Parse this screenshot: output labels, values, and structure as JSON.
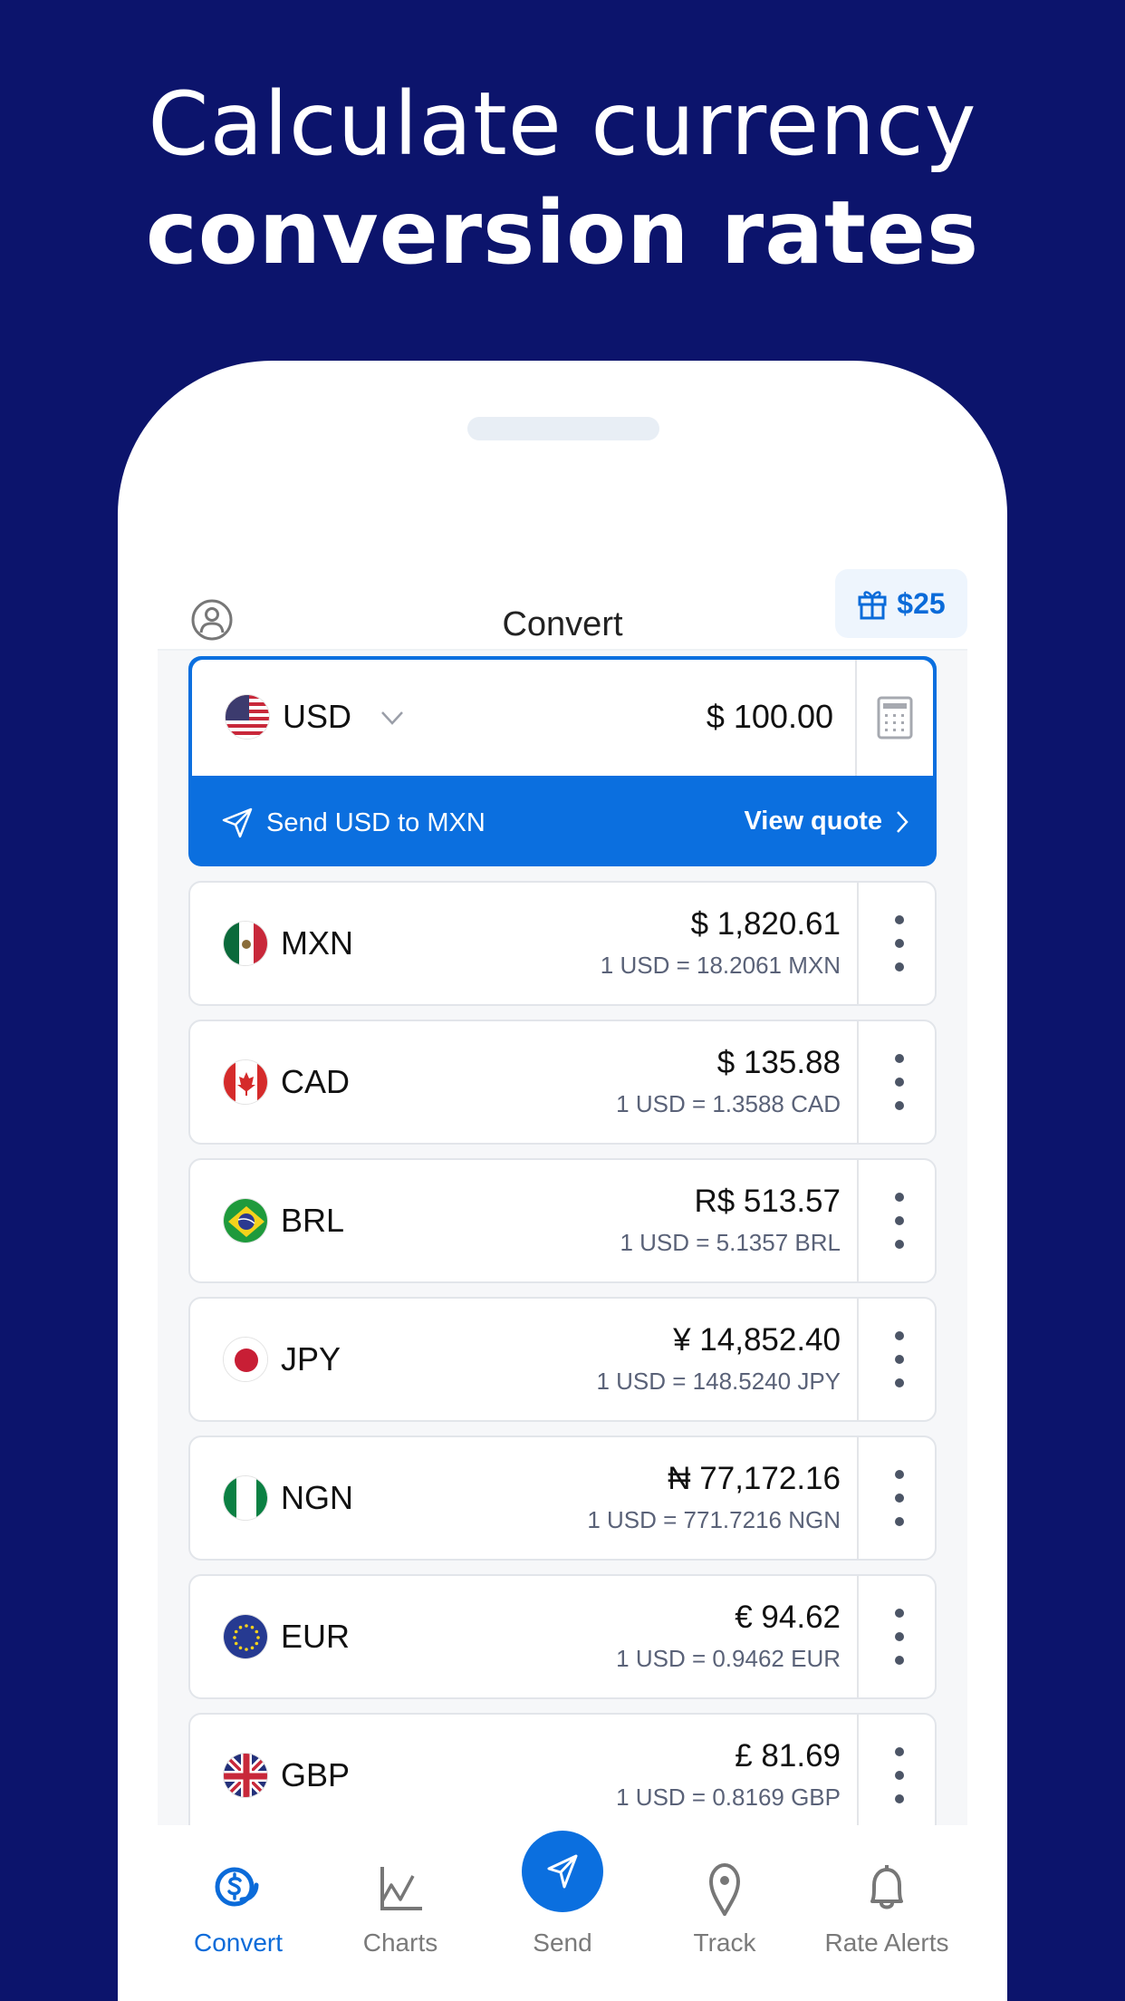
{
  "promo": {
    "line1": "Calculate currency",
    "line2": "conversion rates"
  },
  "app": {
    "title": "Convert",
    "gift": {
      "icon": "gift-icon",
      "label": "$25"
    },
    "profile_icon": "profile-icon"
  },
  "base": {
    "code": "USD",
    "flag": "us",
    "amount": "$ 100.00",
    "send_label": "Send USD to MXN",
    "quote_label": "View quote"
  },
  "currencies": [
    {
      "code": "MXN",
      "flag": "mx",
      "amount": "$ 1,820.61",
      "rate": "1 USD = 18.2061 MXN"
    },
    {
      "code": "CAD",
      "flag": "ca",
      "amount": "$ 135.88",
      "rate": "1 USD = 1.3588 CAD"
    },
    {
      "code": "BRL",
      "flag": "br",
      "amount": "R$ 513.57",
      "rate": "1 USD = 5.1357 BRL"
    },
    {
      "code": "JPY",
      "flag": "jp",
      "amount": "¥ 14,852.40",
      "rate": "1 USD = 148.5240 JPY"
    },
    {
      "code": "NGN",
      "flag": "ng",
      "amount": "₦ 77,172.16",
      "rate": "1 USD = 771.7216 NGN"
    },
    {
      "code": "EUR",
      "flag": "eu",
      "amount": "€ 94.62",
      "rate": "1 USD = 0.9462 EUR"
    },
    {
      "code": "GBP",
      "flag": "gb",
      "amount": "£ 81.69",
      "rate": "1 USD = 0.8169 GBP"
    }
  ],
  "tabs": [
    {
      "label": "Convert",
      "icon": "dollar-coins-icon",
      "active": true
    },
    {
      "label": "Charts",
      "icon": "line-chart-icon",
      "active": false
    },
    {
      "label": "Send",
      "icon": "paper-plane-icon",
      "active": false
    },
    {
      "label": "Track",
      "icon": "map-pin-icon",
      "active": false
    },
    {
      "label": "Rate Alerts",
      "icon": "bell-icon",
      "active": false
    }
  ],
  "colors": {
    "background": "#0c146c",
    "accent": "#0b6fdf",
    "text_secondary": "#5a6278"
  }
}
